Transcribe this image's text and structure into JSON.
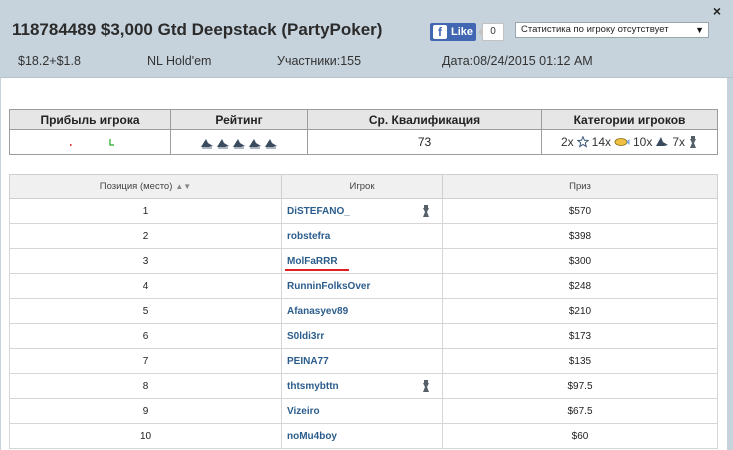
{
  "header": {
    "title": "118784489 $3,000 Gtd Deepstack (PartyPoker)",
    "buyin": "$18.2+$1.8",
    "game": "NL Hold'em",
    "participants": "Участники:155",
    "date": "Дата:08/24/2015 01:12 AM",
    "like_label": "Like",
    "like_count": "0",
    "stats_select": "Статистика по игроку отсутствует"
  },
  "summary": {
    "headers": [
      "Прибыль игрока",
      "Рейтинг",
      "Ср. Квалификация",
      "Категории игроков"
    ],
    "avg_qualification": "73",
    "categories": [
      {
        "count": "2x",
        "icon": "star-outline-icon"
      },
      {
        "count": "14x",
        "icon": "fish-icon"
      },
      {
        "count": "10x",
        "icon": "shark-icon"
      },
      {
        "count": "7x",
        "icon": "crown-icon"
      }
    ]
  },
  "results": {
    "headers": [
      "Позиция (место)",
      "Игрок",
      "Приз"
    ],
    "rows": [
      {
        "pos": "1",
        "player": "DiSTEFANO_",
        "prize": "$570",
        "badge": true,
        "highlight": false
      },
      {
        "pos": "2",
        "player": "robstefra",
        "prize": "$398",
        "badge": false,
        "highlight": false
      },
      {
        "pos": "3",
        "player": "MolFaRRR",
        "prize": "$300",
        "badge": false,
        "highlight": true
      },
      {
        "pos": "4",
        "player": "RunninFolksOver",
        "prize": "$248",
        "badge": false,
        "highlight": false
      },
      {
        "pos": "5",
        "player": "Afanasyev89",
        "prize": "$210",
        "badge": false,
        "highlight": false
      },
      {
        "pos": "6",
        "player": "S0ldi3rr",
        "prize": "$173",
        "badge": false,
        "highlight": false
      },
      {
        "pos": "7",
        "player": "PEINA77",
        "prize": "$135",
        "badge": false,
        "highlight": false
      },
      {
        "pos": "8",
        "player": "thtsmybttn",
        "prize": "$97.5",
        "badge": true,
        "highlight": false
      },
      {
        "pos": "9",
        "player": "Vizeiro",
        "prize": "$67.5",
        "badge": false,
        "highlight": false
      },
      {
        "pos": "10",
        "player": "noMu4boy",
        "prize": "$60",
        "badge": false,
        "highlight": false
      }
    ]
  },
  "colors": {
    "header_bg": "#c6d3dc",
    "link": "#2b5d8c",
    "fb_blue": "#4267b2",
    "highlight_underline": "#e02020"
  }
}
